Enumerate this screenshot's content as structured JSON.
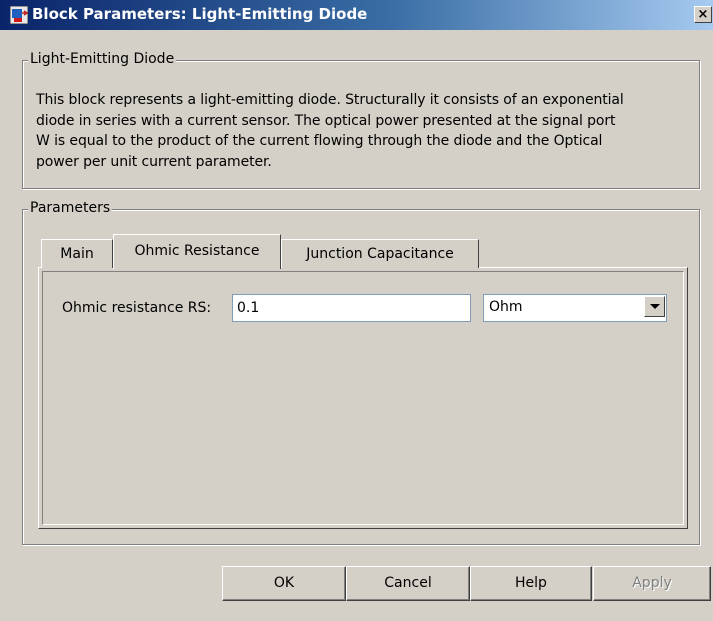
{
  "window": {
    "title": "Block Parameters: Light-Emitting Diode",
    "close_glyph": "×",
    "icon": "simulink-block-icon"
  },
  "description": {
    "group_label": "Light-Emitting Diode",
    "lines": [
      "This block represents a light-emitting diode. Structurally it consists of an exponential",
      "diode in series with a current sensor. The optical power presented at the signal port",
      "W is equal to the product of the current flowing through the diode and the Optical",
      "power per unit current parameter."
    ]
  },
  "parameters": {
    "group_label": "Parameters",
    "tabs": [
      {
        "label": "Main",
        "selected": false
      },
      {
        "label": "Ohmic Resistance",
        "selected": true
      },
      {
        "label": "Junction Capacitance",
        "selected": false
      }
    ],
    "ohmic_resistance": {
      "label": "Ohmic resistance RS:",
      "value": "0.1",
      "unit": "Ohm"
    }
  },
  "buttons": {
    "ok": "OK",
    "cancel": "Cancel",
    "help": "Help",
    "apply": "Apply"
  }
}
